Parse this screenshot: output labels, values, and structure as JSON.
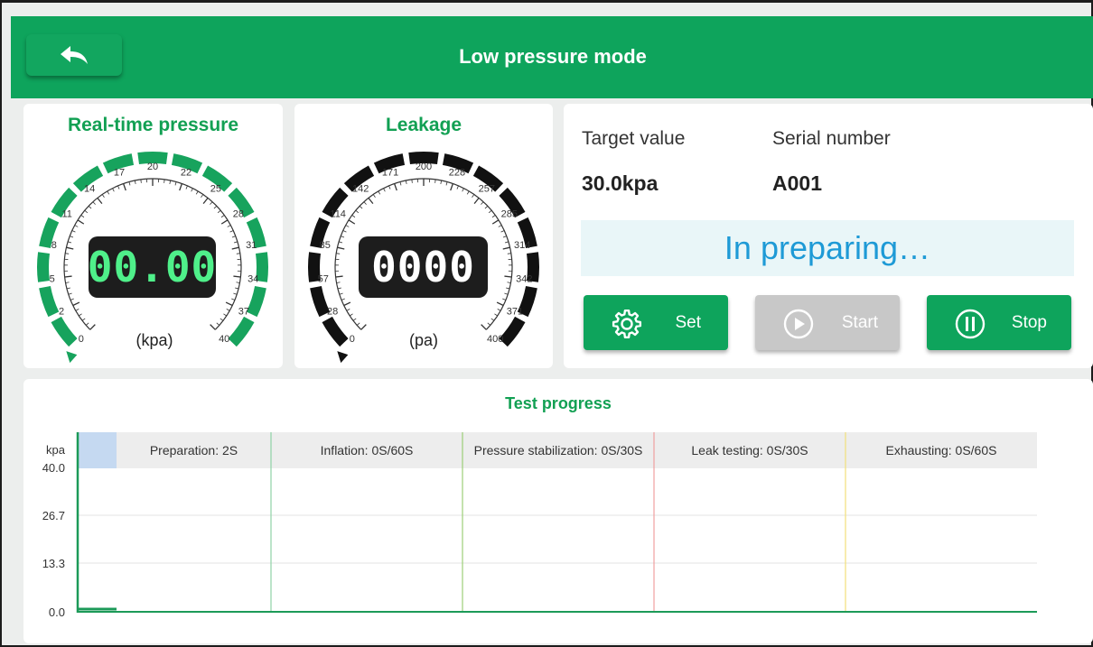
{
  "header": {
    "title": "Low pressure mode",
    "back_icon": "back-arrow-icon"
  },
  "pressure_gauge": {
    "title": "Real-time pressure",
    "reading": "00.00",
    "unit": "(kpa)",
    "ticks": [
      "0",
      "2",
      "5",
      "8",
      "11",
      "14",
      "17",
      "20",
      "22",
      "25",
      "28",
      "31",
      "34",
      "37",
      "40"
    ],
    "min": 0,
    "max": 40,
    "current": 0,
    "color": "#17a35d"
  },
  "leak_gauge": {
    "title": "Leakage",
    "reading": "0000",
    "unit": "(pa)",
    "ticks": [
      "0",
      "28",
      "57",
      "85",
      "114",
      "142",
      "171",
      "200",
      "228",
      "257",
      "285",
      "314",
      "342",
      "371",
      "400"
    ],
    "min": 0,
    "max": 400,
    "current": 0,
    "color": "#111111"
  },
  "info": {
    "target_label": "Target value",
    "target_value": "30.0kpa",
    "serial_label": "Serial number",
    "serial_value": "A001",
    "status": "In preparing…"
  },
  "controls": {
    "set": {
      "label": "Set",
      "icon": "gear-icon",
      "enabled": true
    },
    "start": {
      "label": "Start",
      "icon": "play-icon",
      "enabled": false
    },
    "stop": {
      "label": "Stop",
      "icon": "pause-icon",
      "enabled": true
    }
  },
  "colors": {
    "accent": "#0ea45c",
    "status_text": "#1e9ad6",
    "disabled": "#c8c8c8"
  },
  "progress": {
    "title": "Test progress",
    "y_unit": "kpa",
    "y_ticks": [
      "40.0",
      "26.7",
      "13.3",
      "0.0"
    ],
    "phases": [
      {
        "label": "Preparation: 2S",
        "color": "#9ad8b4"
      },
      {
        "label": "Inflation: 0S/60S",
        "color": "#8fd3a6"
      },
      {
        "label": "Pressure stabilization: 0S/30S",
        "color": "#9ccf77"
      },
      {
        "label": "Leak testing: 0S/30S",
        "color": "#f0a0a0"
      },
      {
        "label": "Exhausting: 0S/60S",
        "color": "#f2e07a"
      }
    ]
  }
}
